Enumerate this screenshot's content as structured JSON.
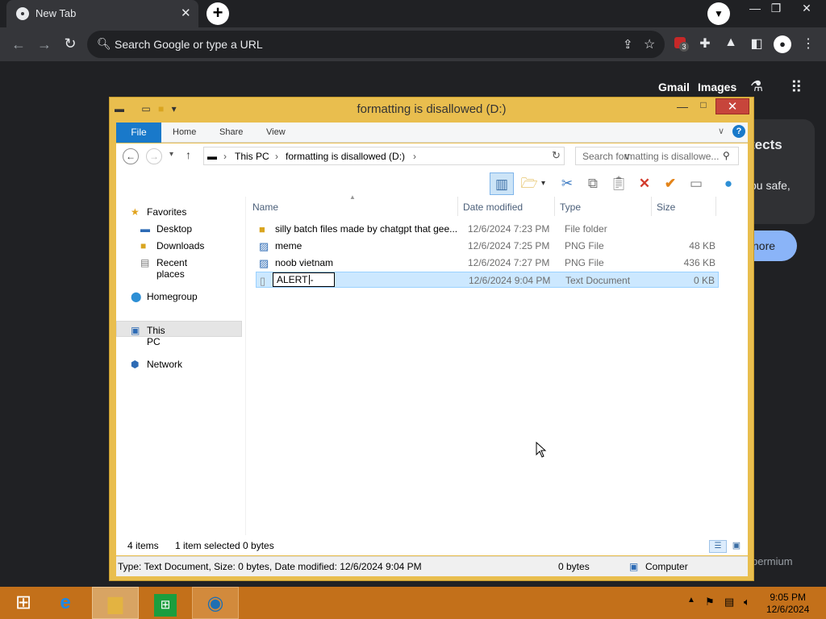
{
  "browser": {
    "tab_title": "New Tab",
    "tab_close": "✕",
    "new_tab": "+",
    "omnibox_placeholder": "Search Google or type a URL",
    "extension_badge": "3",
    "links": {
      "gmail": "Gmail",
      "images": "Images"
    },
    "bg_card": {
      "title_fragment": "tects",
      "text_fragment": "ou safe,",
      "button_fragment": "nore"
    },
    "footer_fragment": "permium"
  },
  "explorer": {
    "title": "formatting is disallowed (D:)",
    "ribbon_tabs": [
      "File",
      "Home",
      "Share",
      "View"
    ],
    "breadcrumb": [
      "This PC",
      "formatting is disallowed (D:)"
    ],
    "search_placeholder": "Search formatting is disallowe...",
    "nav": {
      "favorites": "Favorites",
      "favorites_items": [
        "Desktop",
        "Downloads",
        "Recent places"
      ],
      "homegroup": "Homegroup",
      "this_pc": "This PC",
      "network": "Network"
    },
    "columns": {
      "name": "Name",
      "date": "Date modified",
      "type": "Type",
      "size": "Size"
    },
    "files": [
      {
        "name": "silly batch files made by chatgpt that gee...",
        "date": "12/6/2024 7:23 PM",
        "type": "File folder",
        "size": "",
        "icon": "folder-icon"
      },
      {
        "name": "meme",
        "date": "12/6/2024 7:25 PM",
        "type": "PNG File",
        "size": "48 KB",
        "icon": "image-file-icon"
      },
      {
        "name": "noob vietnam",
        "date": "12/6/2024 7:27 PM",
        "type": "PNG File",
        "size": "436 KB",
        "icon": "image-file-icon"
      },
      {
        "name": "ALERT -",
        "date": "12/6/2024 9:04 PM",
        "type": "Text Document",
        "size": "0 KB",
        "icon": "text-file-icon"
      }
    ],
    "status": {
      "items": "4 items",
      "selected": "1 item selected  0 bytes"
    },
    "details_bar": {
      "info": "Type: Text Document, Size: 0 bytes, Date modified: 12/6/2024 9:04 PM",
      "size": "0 bytes",
      "location": "Computer"
    }
  },
  "taskbar": {
    "time": "9:05 PM",
    "date": "12/6/2024"
  }
}
